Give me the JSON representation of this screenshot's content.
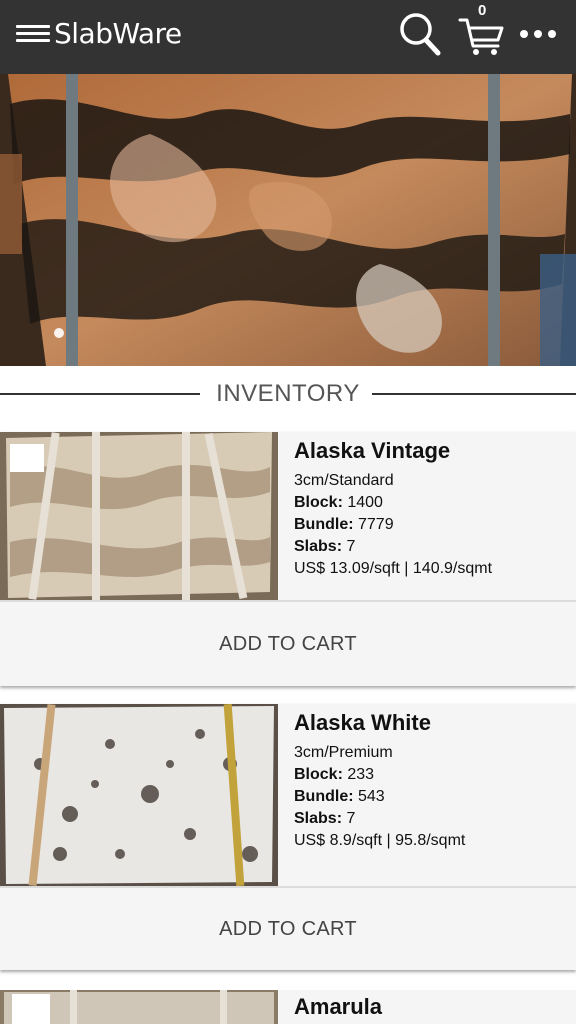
{
  "app": {
    "title": "SlabWare",
    "cart_count": "0"
  },
  "icons": {
    "menu": "hamburger-menu-icon",
    "search": "search-icon",
    "cart": "shopping-cart-icon",
    "more": "more-dots-icon"
  },
  "colors": {
    "topbar": "#333333",
    "card_background": "#f5f5f5"
  },
  "section": {
    "title": "INVENTORY"
  },
  "products": [
    {
      "name": "Alaska Vintage",
      "finish": "3cm/Standard",
      "block_label": "Block:",
      "block": "1400",
      "bundle_label": "Bundle:",
      "bundle": "7779",
      "slabs_label": "Slabs:",
      "slabs": "7",
      "price": "US$ 13.09/sqft | 140.9/sqmt",
      "button": "ADD TO CART"
    },
    {
      "name": "Alaska White",
      "finish": "3cm/Premium",
      "block_label": "Block:",
      "block": "233",
      "bundle_label": "Bundle:",
      "bundle": "543",
      "slabs_label": "Slabs:",
      "slabs": "7",
      "price": "US$ 8.9/sqft | 95.8/sqmt",
      "button": "ADD TO CART"
    },
    {
      "name": "Amarula"
    }
  ]
}
